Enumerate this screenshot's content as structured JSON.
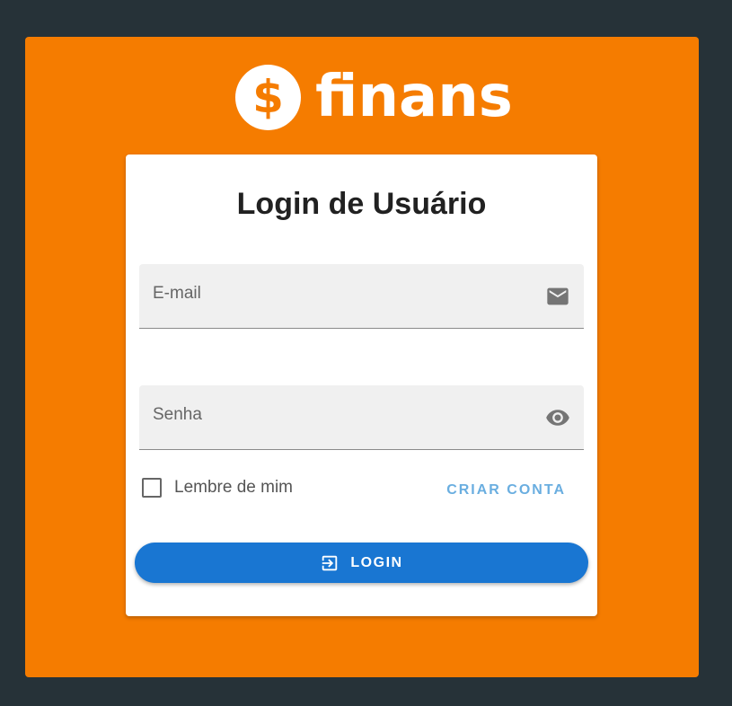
{
  "brand": {
    "name": "finans",
    "coin_symbol": "$"
  },
  "login_form": {
    "title": "Login de Usuário",
    "email_label": "E-mail",
    "password_label": "Senha",
    "remember_label": "Lembre de mim",
    "remember_checked": false,
    "create_account_label": "CRIAR CONTA",
    "submit_label": "LOGIN"
  },
  "icons": {
    "email_field": "email-icon",
    "password_field": "eye-icon",
    "submit": "login-icon"
  },
  "colors": {
    "background": "#263238",
    "panel": "#f57c00",
    "primary": "#1976d2",
    "link": "#6aaee0"
  }
}
